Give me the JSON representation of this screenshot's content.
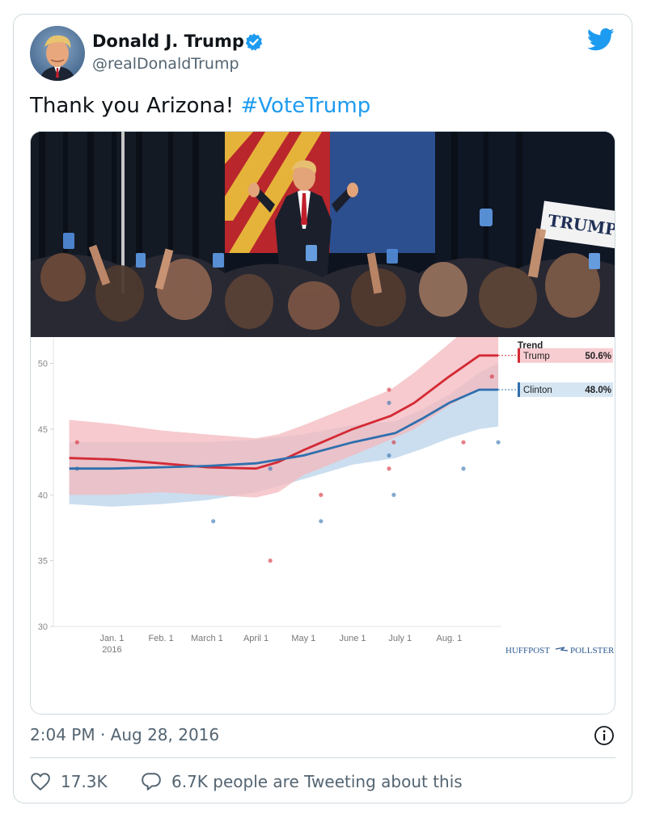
{
  "tweet": {
    "author_name": "Donald J. Trump",
    "author_handle": "@realDonaldTrump",
    "text_prefix": "Thank you Arizona! ",
    "hashtag": "#VoteTrump",
    "timestamp": "2:04 PM · Aug 28, 2016",
    "likes": "17.3K",
    "tweeting_about": "6.7K people are Tweeting about this",
    "brand_color": "#1d9bf0",
    "icons": [
      "verified-badge-icon",
      "twitter-bird-icon",
      "info-icon",
      "heart-icon",
      "speech-bubble-icon"
    ]
  },
  "photo": {
    "sign_text": "TRUMP"
  },
  "chart_data": {
    "type": "line",
    "title": "",
    "ylim": [
      30,
      52
    ],
    "yticks": [
      30,
      35,
      40,
      45,
      50
    ],
    "xtick_labels": [
      {
        "label": "Jan. 1",
        "sub": "2016",
        "x": "2016-01-01"
      },
      {
        "label": "Feb. 1",
        "x": "2016-02-01"
      },
      {
        "label": "March 1",
        "x": "2016-03-01"
      },
      {
        "label": "April 1",
        "x": "2016-04-01"
      },
      {
        "label": "May 1",
        "x": "2016-05-01"
      },
      {
        "label": "June 1",
        "x": "2016-06-01"
      },
      {
        "label": "July 1",
        "x": "2016-07-01"
      },
      {
        "label": "Aug. 1",
        "x": "2016-08-01"
      }
    ],
    "legend": {
      "title": "Trend",
      "position": "right"
    },
    "brand_left": "HUFFPOST",
    "brand_right": "POLLSTER",
    "series": [
      {
        "name": "Trump",
        "value_label": "50.6%",
        "color": "#d42a35",
        "band_color": "#f3b8bd",
        "x": [
          "2015-12-05",
          "2016-01-01",
          "2016-02-01",
          "2016-03-01",
          "2016-04-01",
          "2016-04-15",
          "2016-05-01",
          "2016-06-01",
          "2016-06-25",
          "2016-07-10",
          "2016-08-01",
          "2016-08-20",
          "2016-09-01"
        ],
        "y": [
          42.8,
          42.7,
          42.4,
          42.1,
          42.0,
          42.5,
          43.4,
          45.0,
          46.0,
          47.0,
          49.0,
          50.6,
          50.6
        ],
        "upper": [
          45.7,
          45.4,
          44.9,
          44.6,
          44.3,
          44.6,
          45.3,
          46.8,
          48.0,
          49.3,
          51.5,
          53.5,
          53.5
        ],
        "lower": [
          40.0,
          40.0,
          40.2,
          40.0,
          39.8,
          40.2,
          41.5,
          43.0,
          44.2,
          45.0,
          46.8,
          48.0,
          48.0
        ],
        "polls": [
          {
            "x": "2015-12-10",
            "y": 44
          },
          {
            "x": "2016-04-10",
            "y": 35
          },
          {
            "x": "2016-05-12",
            "y": 40
          },
          {
            "x": "2016-06-24",
            "y": 48
          },
          {
            "x": "2016-06-24",
            "y": 42
          },
          {
            "x": "2016-06-27",
            "y": 44
          },
          {
            "x": "2016-08-10",
            "y": 44
          },
          {
            "x": "2016-08-28",
            "y": 49
          }
        ]
      },
      {
        "name": "Clinton",
        "value_label": "48.0%",
        "color": "#2f6fad",
        "band_color": "#c5daed",
        "x": [
          "2015-12-05",
          "2016-01-01",
          "2016-02-01",
          "2016-03-01",
          "2016-04-01",
          "2016-05-01",
          "2016-06-01",
          "2016-06-28",
          "2016-07-15",
          "2016-08-01",
          "2016-08-20",
          "2016-09-01"
        ],
        "y": [
          42.0,
          42.0,
          42.1,
          42.2,
          42.4,
          43.0,
          44.0,
          44.7,
          45.8,
          47.0,
          48.0,
          48.0
        ],
        "upper": [
          44.0,
          44.0,
          44.0,
          44.0,
          44.2,
          44.6,
          45.3,
          45.6,
          46.5,
          47.6,
          49.3,
          50.0
        ],
        "lower": [
          39.3,
          39.1,
          39.3,
          39.6,
          40.2,
          41.2,
          42.3,
          42.8,
          43.5,
          44.3,
          45.0,
          45.2
        ],
        "polls": [
          {
            "x": "2015-12-10",
            "y": 42
          },
          {
            "x": "2016-03-05",
            "y": 38
          },
          {
            "x": "2016-04-10",
            "y": 42
          },
          {
            "x": "2016-05-12",
            "y": 38
          },
          {
            "x": "2016-06-24",
            "y": 47
          },
          {
            "x": "2016-06-24",
            "y": 43
          },
          {
            "x": "2016-06-27",
            "y": 40
          },
          {
            "x": "2016-08-10",
            "y": 42
          },
          {
            "x": "2016-09-01",
            "y": 44
          }
        ]
      }
    ]
  }
}
